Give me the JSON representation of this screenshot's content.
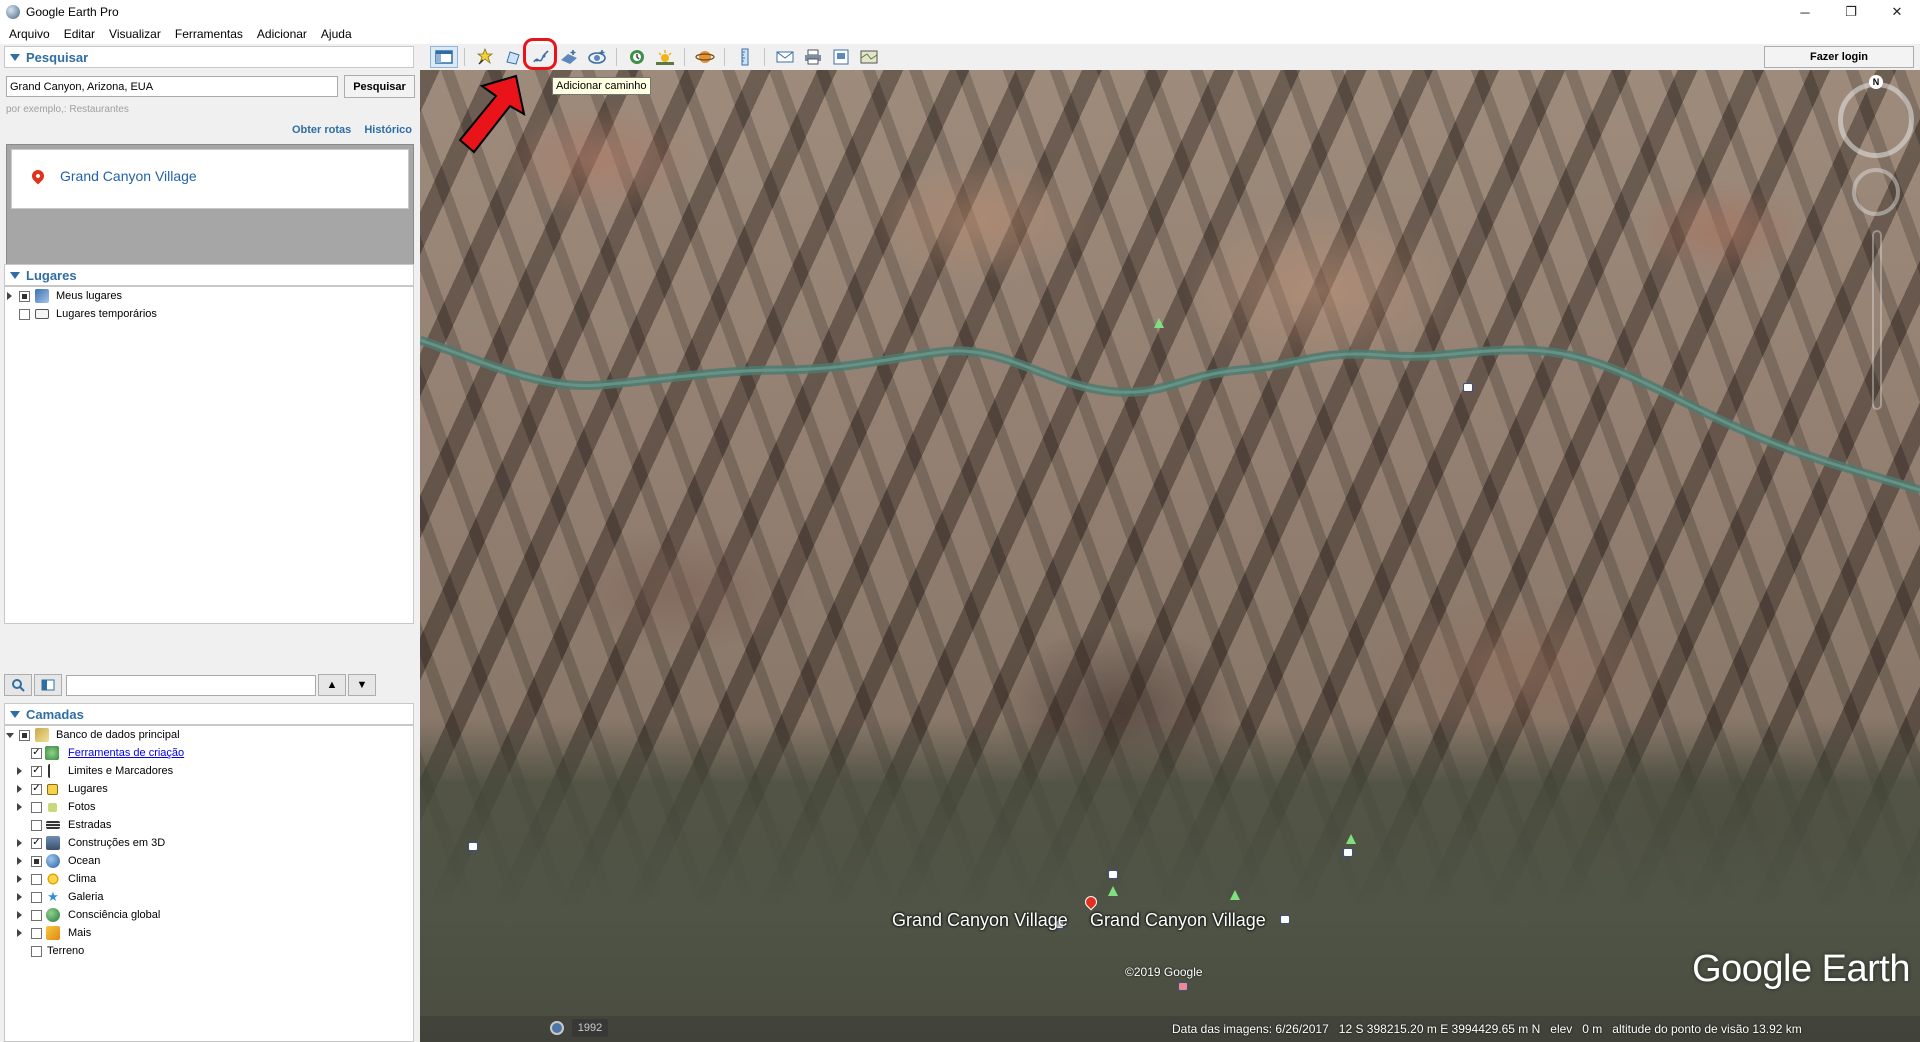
{
  "window": {
    "title": "Google Earth Pro",
    "controls": [
      "─",
      "❐",
      "✕"
    ]
  },
  "menu": [
    "Arquivo",
    "Editar",
    "Visualizar",
    "Ferramentas",
    "Adicionar",
    "Ajuda"
  ],
  "search": {
    "header": "Pesquisar",
    "input_value": "Grand Canyon, Arizona, EUA",
    "button": "Pesquisar",
    "hint": "por exemplo,: Restaurantes",
    "links": [
      "Obter rotas",
      "Histórico"
    ],
    "results": [
      "Grand Canyon Village"
    ]
  },
  "places": {
    "header": "Lugares",
    "items": [
      "Meus lugares",
      "Lugares temporários"
    ]
  },
  "layers": {
    "header": "Camadas",
    "root": "Banco de dados principal",
    "items": [
      {
        "label": "Ferramentas de criação",
        "checked": true
      },
      {
        "label": "Limites e Marcadores",
        "checked": true
      },
      {
        "label": "Lugares",
        "checked": true
      },
      {
        "label": "Fotos",
        "checked": false
      },
      {
        "label": "Estradas",
        "checked": false
      },
      {
        "label": "Construções em 3D",
        "checked": true
      },
      {
        "label": "Ocean",
        "checked": "partial"
      },
      {
        "label": "Clima",
        "checked": false
      },
      {
        "label": "Galeria",
        "checked": false
      },
      {
        "label": "Consciência global",
        "checked": false
      },
      {
        "label": "Mais",
        "checked": false
      },
      {
        "label": "Terreno",
        "checked": false
      }
    ]
  },
  "toolbar": {
    "login": "Fazer login",
    "tooltip": "Adicionar caminho"
  },
  "map": {
    "labels": [
      "Grand Canyon Village",
      "Grand Canyon Village"
    ],
    "copyright": "©2019 Google",
    "brand": "Google Earth",
    "north": "N",
    "year": "1992"
  },
  "status": {
    "imagery_date": "Data das imagens: 6/26/2017",
    "coords": "12 S 398215.20 m E 3994429.65 m N",
    "elev_label": "elev",
    "elev_value": "0 m",
    "eye_alt": "altitude do ponto de visão  13.92 km"
  },
  "colors": {
    "accent": "#2f6ea3",
    "highlight": "#e8141a",
    "link": "#2462a8"
  }
}
